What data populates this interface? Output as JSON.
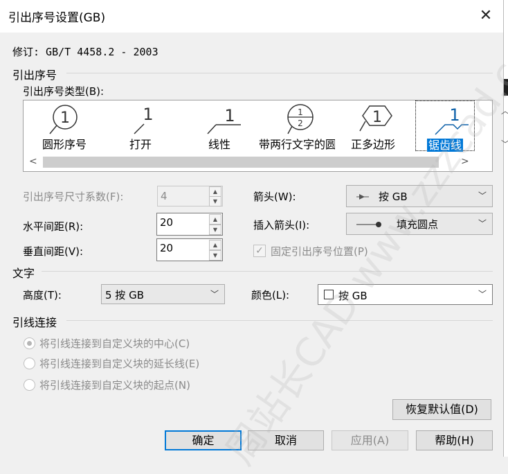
{
  "window": {
    "title": "引出序号设置(GB)",
    "close_glyph": "✕"
  },
  "revision": "修订: GB/T 4458.2 - 2003",
  "balloon_section": {
    "heading": "引出序号",
    "type_label": "引出序号类型(B):",
    "types": [
      {
        "label": "圆形序号",
        "icon": "circle-balloon-icon"
      },
      {
        "label": "打开",
        "icon": "open-balloon-icon"
      },
      {
        "label": "线性",
        "icon": "linear-balloon-icon"
      },
      {
        "label": "带两行文字的圆形序号",
        "icon": "two-line-circle-balloon-icon"
      },
      {
        "label": "正多边形",
        "icon": "polygon-balloon-icon"
      },
      {
        "label": "锯齿线",
        "icon": "zigzag-balloon-icon",
        "selected": true
      }
    ],
    "glyph_1": "1",
    "glyph_2": "2",
    "size_factor_label": "引出序号尺寸系数(F):",
    "size_factor_value": "4",
    "h_spacing_label": "水平间距(R):",
    "h_spacing_value": "20",
    "v_spacing_label": "垂直间距(V):",
    "v_spacing_value": "20",
    "arrow_label": "箭头(W):",
    "arrow_value": "按 GB",
    "insert_arrow_label": "插入箭头(I):",
    "insert_arrow_value": "填充圆点",
    "fix_position_label": "固定引出序号位置(P)",
    "fix_position_checked": true
  },
  "text_section": {
    "heading": "文字",
    "height_label": "高度(T):",
    "height_value": "5  按 GB",
    "color_label": "颜色(L):",
    "color_value": "按 GB"
  },
  "leader_section": {
    "heading": "引线连接",
    "options": [
      {
        "label": "将引线连接到自定义块的中心(C)",
        "checked": true
      },
      {
        "label": "将引线连接到自定义块的延长线(E)",
        "checked": false
      },
      {
        "label": "将引线连接到自定义块的起点(N)",
        "checked": false
      }
    ]
  },
  "buttons": {
    "restore_defaults": "恢复默认值(D)",
    "ok": "确定",
    "cancel": "取消",
    "apply": "应用(A)",
    "help": "帮助(H)"
  },
  "watermark": "周站长CAD  www.zzzcad.com"
}
